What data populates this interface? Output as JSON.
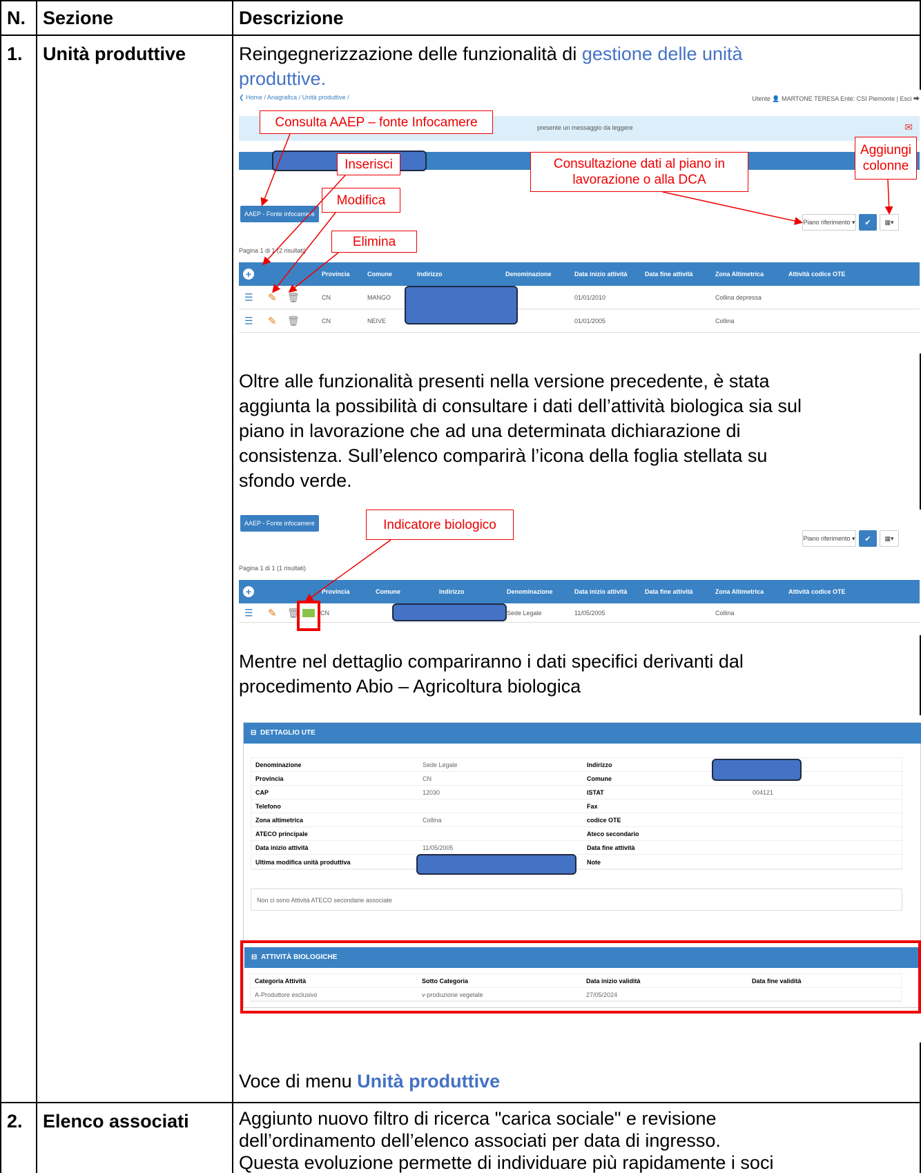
{
  "table": {
    "headers": {
      "n": "N.",
      "sezione": "Sezione",
      "descrizione": "Descrizione"
    },
    "rows": [
      {
        "n": "1.",
        "sezione": "Unità produttive",
        "intro_plain": "Reingegnerizzazione delle funzionalità di ",
        "intro_link_1": "gestione delle unità",
        "intro_link_2": "produttive.",
        "para2": [
          "Oltre alle funzionalità presenti nella versione precedente, è stata",
          "aggiunta la possibilità di consultare i dati dell’attività biologica sia sul",
          "piano in lavorazione che ad una determinata dichiarazione di",
          "consistenza. Sull’elenco comparirà l’icona della foglia stellata su",
          "sfondo verde."
        ],
        "para3": [
          "Mentre nel dettaglio compariranno i dati specifici derivanti dal",
          "procedimento Abio – Agricoltura biologica"
        ],
        "menu_prefix": "Voce di menu ",
        "menu_link": "Unità produttive"
      },
      {
        "n": "2.",
        "sezione": "Elenco associati",
        "lines": [
          "Aggiunto nuovo filtro di ricerca \"carica sociale\" e revisione",
          "dell’ordinamento dell’elenco associati per data di ingresso.",
          "Questa evoluzione permette di individuare più rapidamente i soci"
        ]
      }
    ]
  },
  "shot1": {
    "breadcrumb": "❮ Home / Anagrafica / Unità produttive /",
    "user": "Utente 👤 MARTONE TERESA   Ente: CSI Piemonte | Esci ⮕",
    "message": "presente un messaggio da leggere",
    "aaep_button": "AAEP - Fonte infocamere",
    "piano_button": "Piano riferimento ▾",
    "pagina": "Pagina 1 di 1 (2 risultati)",
    "columns": [
      "Provincia",
      "Comune",
      "Indirizzo",
      "Denominazione",
      "Data inizio attività",
      "Data fine attività",
      "Zona Altimetrica",
      "Attività codice OTE"
    ],
    "rows": [
      {
        "provincia": "CN",
        "comune": "MANGO",
        "data_inizio": "01/01/2010",
        "zona": "Collina depressa"
      },
      {
        "provincia": "CN",
        "comune": "NEIVE",
        "data_inizio": "01/01/2005",
        "zona": "Collina"
      }
    ],
    "callouts": {
      "aaep": "Consulta AAEP – fonte Infocamere",
      "inserisci": "Inserisci",
      "modifica": "Modifica",
      "elimina": "Elimina",
      "consultazione_1": "Consultazione dati al piano in",
      "consultazione_2": "lavorazione o alla DCA",
      "aggiungi_1": "Aggiungi",
      "aggiungi_2": "colonne"
    }
  },
  "shot2": {
    "aaep_button": "AAEP - Fonte infocamere",
    "piano_button": "Piano riferimento ▾",
    "pagina": "Pagina 1 di 1 (1 risultati)",
    "columns": [
      "Provincia",
      "Comune",
      "Indirizzo",
      "Denominazione",
      "Data inizio attività",
      "Data fine attività",
      "Zona Altimetrica",
      "Attività codice OTE"
    ],
    "row": {
      "provincia": "CN",
      "denominazione": "Sede Legale",
      "data_inizio": "11/05/2005",
      "zona": "Collina"
    },
    "callout": "Indicatore biologico"
  },
  "shot3": {
    "panel_title": "DETTAGLIO UTE",
    "rows": [
      {
        "l1": "Denominazione",
        "v1": "Sede Legale",
        "l2": "Indirizzo",
        "v2": ""
      },
      {
        "l1": "Provincia",
        "v1": "CN",
        "l2": "Comune",
        "v2": ""
      },
      {
        "l1": "CAP",
        "v1": "12030",
        "l2": "ISTAT",
        "v2": "004121"
      },
      {
        "l1": "Telefono",
        "v1": "",
        "l2": "Fax",
        "v2": ""
      },
      {
        "l1": "Zona altimetrica",
        "v1": "Collina",
        "l2": "codice OTE",
        "v2": ""
      },
      {
        "l1": "ATECO principale",
        "v1": "",
        "l2": "Ateco secondario",
        "v2": ""
      },
      {
        "l1": "Data inizio attività",
        "v1": "11/05/2005",
        "l2": "Data fine attività",
        "v2": ""
      },
      {
        "l1": "Ultima modifica unità produttiva",
        "v1": "",
        "l2": "Note",
        "v2": ""
      }
    ],
    "no_ateco": "Non ci sono Attività ATECO secondarie associate",
    "bio_title": "ATTIVITÀ BIOLOGICHE",
    "bio_columns": [
      "Categoria Attività",
      "Sotto Categoria",
      "Data inizio validità",
      "Data fine validità"
    ],
    "bio_row": [
      "A-Produttore esclusivo",
      "v-produzione vegetale",
      "27/05/2024",
      ""
    ]
  }
}
